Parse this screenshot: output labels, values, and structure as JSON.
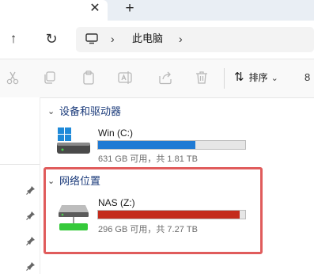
{
  "tabs": {
    "close_glyph": "✕",
    "new_tab_glyph": "+"
  },
  "nav": {
    "up_glyph": "↑",
    "refresh_glyph": "↻"
  },
  "address": {
    "sep_glyph": "›",
    "crumb": "此电脑"
  },
  "toolbar": {
    "icons": [
      "cut-icon",
      "copy-icon",
      "paste-icon",
      "rename-icon",
      "share-icon",
      "delete-icon"
    ],
    "sort_icon_glyph": "⇅",
    "sort_label": "排序",
    "sort_chevron": "⌄",
    "more_glyph": "8"
  },
  "sections": [
    {
      "chevron": "⌄",
      "title": "设备和驱动器",
      "drives": [
        {
          "name": "Win (C:)",
          "info": "631 GB 可用，共 1.81 TB",
          "used_fraction": 0.66,
          "bar_color": "#1f7ad4"
        }
      ]
    },
    {
      "chevron": "⌄",
      "title": "网络位置",
      "drives": [
        {
          "name": "NAS (Z:)",
          "info": "296 GB 可用，共 7.27 TB",
          "used_fraction": 0.96,
          "bar_color": "#c42b1c"
        }
      ]
    }
  ],
  "colors": {
    "highlight_border": "#e05c5c",
    "section_title": "#1a3a7a"
  }
}
